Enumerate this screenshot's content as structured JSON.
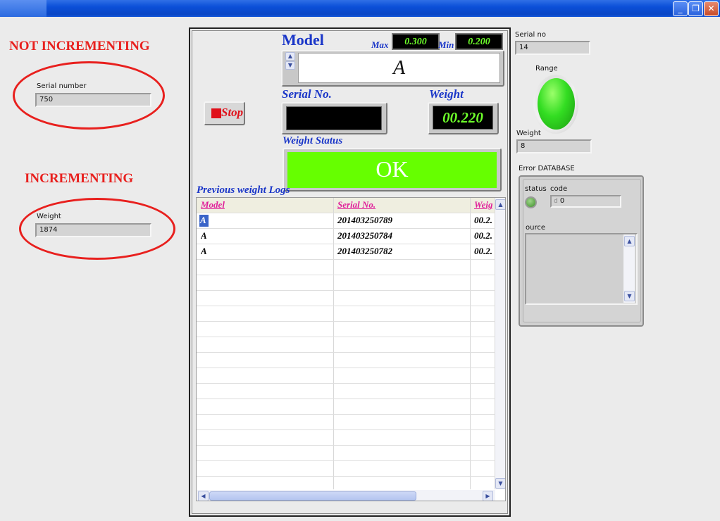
{
  "window": {
    "minimize_glyph": "_",
    "restore_glyph": "❐",
    "close_glyph": "✕"
  },
  "annotations": {
    "not_incrementing": "NOT INCREMENTING",
    "incrementing": "INCREMENTING",
    "color": "#e8201e"
  },
  "left_indicators": {
    "serial_number": {
      "label": "Serial number",
      "value": "750"
    },
    "weight": {
      "label": "Weight",
      "value": "1874"
    }
  },
  "main": {
    "model_title": "Model",
    "max_label": "Max",
    "max_value": "0.300",
    "min_label": "Min",
    "min_value": "0.200",
    "model_value": "A",
    "stop_label": "Stop",
    "serial_title": "Serial No.",
    "serial_value": "",
    "weight_title": "Weight",
    "weight_value": "00.220",
    "weight_status_title": "Weight Status",
    "weight_status_value": "OK",
    "status_color": "#66ff00",
    "previous_logs_title": "Previous weight Logs"
  },
  "table": {
    "columns": [
      "Model",
      "Serial No.",
      "Weig"
    ],
    "rows": [
      [
        "A",
        "201403250789",
        "00.2."
      ],
      [
        "A",
        "201403250784",
        "00.2."
      ],
      [
        "A",
        "201403250782",
        "00.2."
      ]
    ]
  },
  "right": {
    "serial_no": {
      "label": "Serial no",
      "value": "14"
    },
    "range": {
      "label": "Range",
      "led_color": "#33dd22"
    },
    "weight": {
      "label": "Weight",
      "value": "8"
    },
    "error_cluster": {
      "title": "Error DATABASE",
      "status_label": "status",
      "code_label": "code",
      "code_prefix": "d",
      "code_value": "0",
      "source_label": "ource"
    }
  }
}
